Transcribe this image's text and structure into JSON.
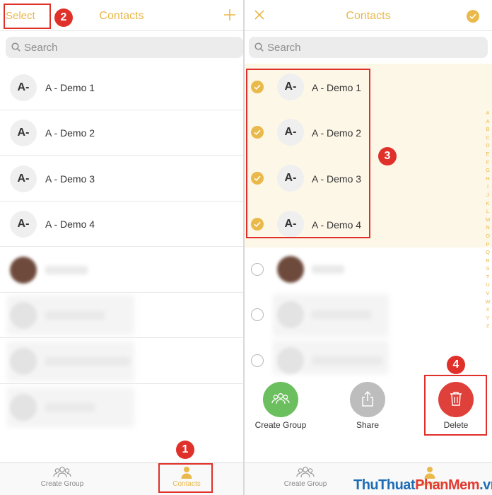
{
  "left": {
    "select_label": "Select",
    "title": "Contacts",
    "search_placeholder": "Search",
    "contacts": [
      {
        "initials": "A-",
        "name": "A - Demo 1"
      },
      {
        "initials": "A-",
        "name": "A - Demo 2"
      },
      {
        "initials": "A-",
        "name": "A - Demo 3"
      },
      {
        "initials": "A-",
        "name": "A - Demo 4"
      }
    ],
    "tabs": [
      {
        "label": "Create Group",
        "icon": "group-icon"
      },
      {
        "label": "Contacts",
        "icon": "person-icon",
        "active": true
      }
    ]
  },
  "right": {
    "title": "Contacts",
    "search_placeholder": "Search",
    "contacts": [
      {
        "initials": "A-",
        "name": "A - Demo 1",
        "checked": true
      },
      {
        "initials": "A-",
        "name": "A - Demo 2",
        "checked": true
      },
      {
        "initials": "A-",
        "name": "A - Demo 3",
        "checked": true
      },
      {
        "initials": "A-",
        "name": "A - Demo 4",
        "checked": true
      }
    ],
    "index_letters": "#ABCDEFGHIJKLMNOPQRSTUVWXYZ",
    "actions": [
      {
        "label": "Create Group",
        "color": "#6cbf5e"
      },
      {
        "label": "Share",
        "color": "#bdbdbd"
      },
      {
        "label": "Delete",
        "color": "#e0403a"
      }
    ],
    "tabs": [
      {
        "label": "Create Group",
        "icon": "group-icon"
      },
      {
        "label": "Contacts",
        "icon": "person-icon",
        "active": true
      }
    ]
  },
  "markers": [
    "1",
    "2",
    "3",
    "4"
  ],
  "watermark": {
    "part1": "ThuThuat",
    "part2": "PhanMem",
    "part3": ".vn"
  },
  "colors": {
    "accent": "#e9b84a",
    "annotation": "#e0302a",
    "selection_bg": "#fdf7e8"
  }
}
